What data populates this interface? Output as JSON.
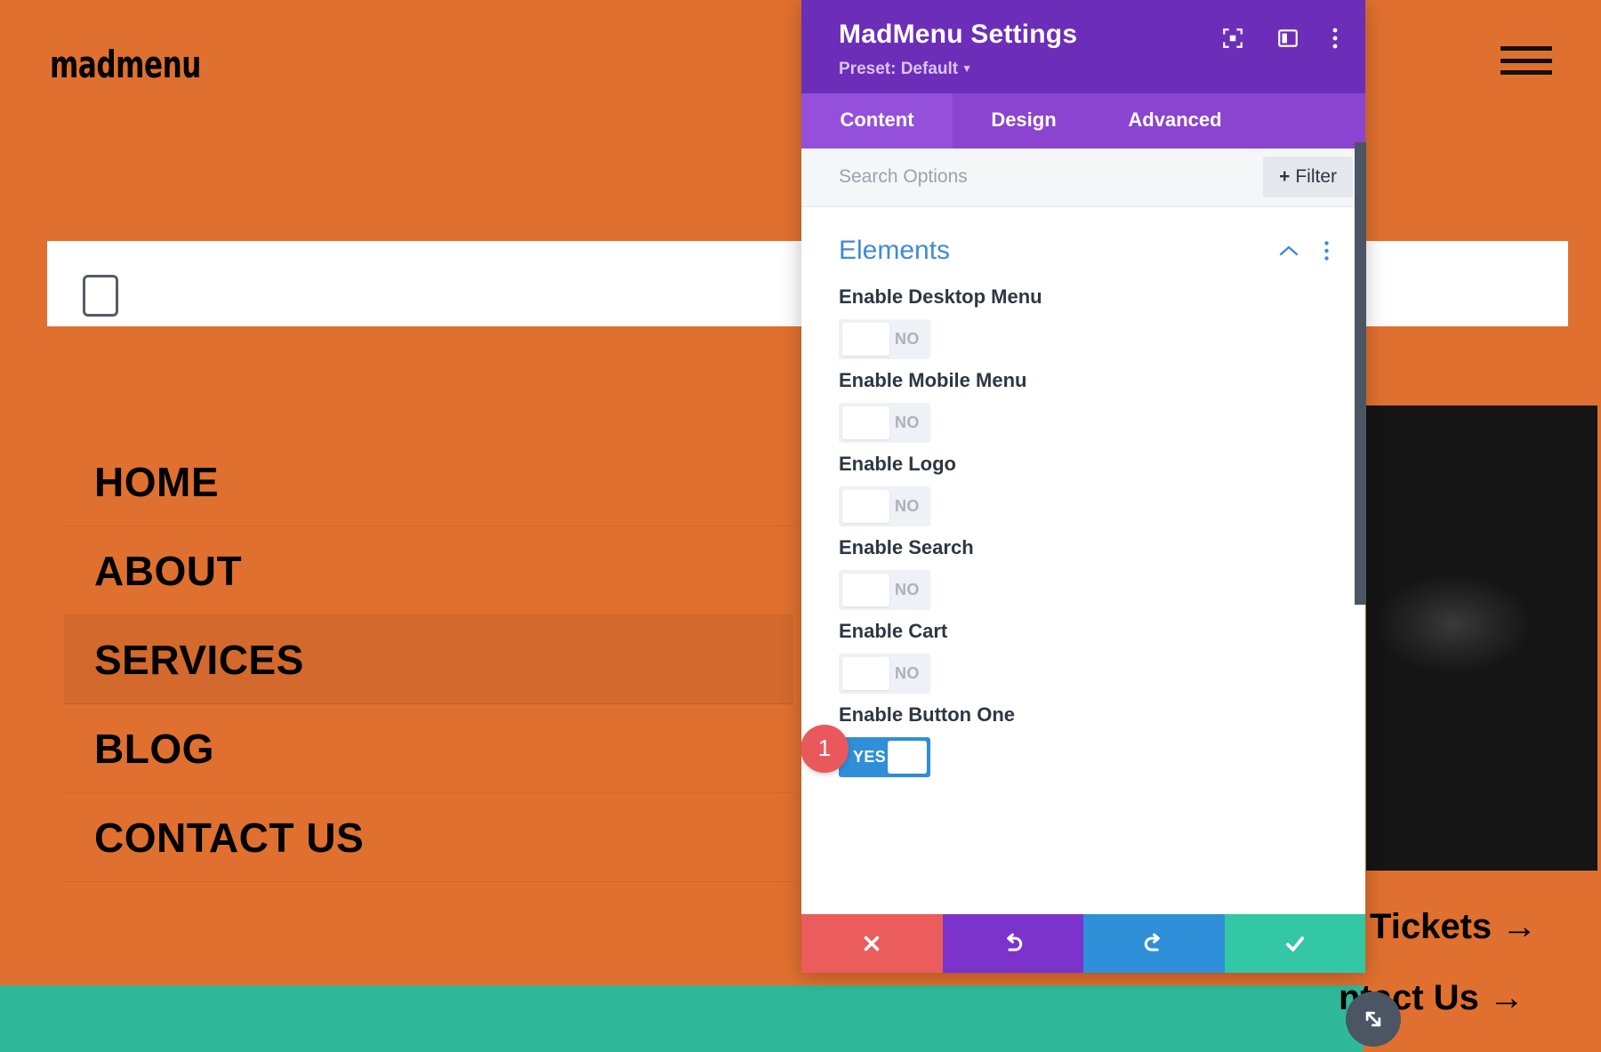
{
  "site": {
    "logo": "madmenu",
    "menu_icon": "hamburger-icon",
    "nav_items": [
      {
        "label": "HOME",
        "active": false
      },
      {
        "label": "ABOUT",
        "active": false
      },
      {
        "label": "SERVICES",
        "active": true
      },
      {
        "label": "BLOG",
        "active": false
      },
      {
        "label": "CONTACT US",
        "active": false
      }
    ],
    "links": {
      "tickets": "Tickets →",
      "contact": "ntact Us →"
    },
    "colors": {
      "background": "#e0702f",
      "teal_block": "#2fb99a",
      "text": "#000000"
    }
  },
  "modal": {
    "title": "MadMenu Settings",
    "preset_label": "Preset: Default",
    "header_icons": [
      "focus-icon",
      "layout-panel-icon",
      "vertical-dots-icon"
    ],
    "tabs": [
      {
        "label": "Content",
        "active": true
      },
      {
        "label": "Design",
        "active": false
      },
      {
        "label": "Advanced",
        "active": false
      }
    ],
    "search": {
      "placeholder": "Search Options",
      "value": "",
      "filter_label": "Filter",
      "filter_plus": "+"
    },
    "section": {
      "title": "Elements",
      "collapse_icon": "chevron-up-icon",
      "more_icon": "vertical-dots-icon"
    },
    "options": [
      {
        "label": "Enable Desktop Menu",
        "state": "NO",
        "on": false
      },
      {
        "label": "Enable Mobile Menu",
        "state": "NO",
        "on": false
      },
      {
        "label": "Enable Logo",
        "state": "NO",
        "on": false
      },
      {
        "label": "Enable Search",
        "state": "NO",
        "on": false
      },
      {
        "label": "Enable Cart",
        "state": "NO",
        "on": false
      },
      {
        "label": "Enable Button One",
        "state": "YES",
        "on": true
      }
    ],
    "badge": "1",
    "footer": [
      {
        "name": "cancel",
        "icon": "close-icon"
      },
      {
        "name": "undo",
        "icon": "undo-icon"
      },
      {
        "name": "redo",
        "icon": "redo-icon"
      },
      {
        "name": "save",
        "icon": "check-icon"
      }
    ],
    "colors": {
      "header": "#6c2eb9",
      "tabs": "#8a44cf",
      "tab_active": "#9450db",
      "section_title": "#3f8bd8",
      "toggle_on": "#2f8fd8",
      "badge": "#e9595b",
      "cancel": "#eb5c5c",
      "undo": "#7c33cc",
      "redo": "#2f8fd8",
      "save": "#34c7a5"
    }
  }
}
